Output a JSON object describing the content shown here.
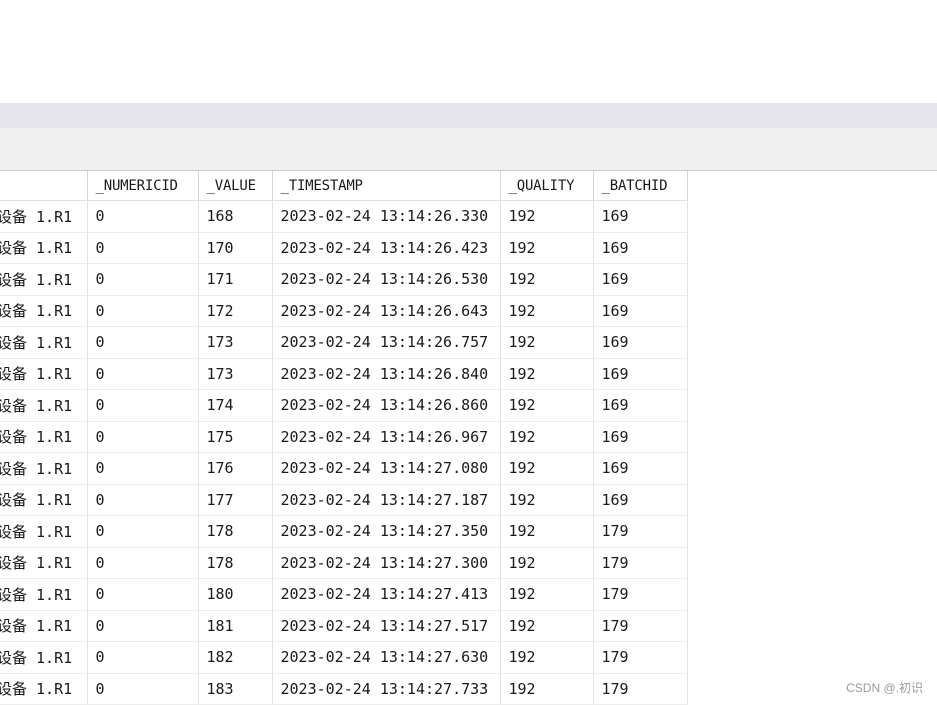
{
  "results_grid": {
    "columns": [
      "",
      "_NUMERICID",
      "_VALUE",
      "_TIMESTAMP",
      "_QUALITY",
      "_BATCHID"
    ],
    "rows": [
      [
        "设备 1.R1",
        "0",
        "168",
        "2023-02-24 13:14:26.330",
        "192",
        "169"
      ],
      [
        "设备 1.R1",
        "0",
        "170",
        "2023-02-24 13:14:26.423",
        "192",
        "169"
      ],
      [
        "设备 1.R1",
        "0",
        "171",
        "2023-02-24 13:14:26.530",
        "192",
        "169"
      ],
      [
        "设备 1.R1",
        "0",
        "172",
        "2023-02-24 13:14:26.643",
        "192",
        "169"
      ],
      [
        "设备 1.R1",
        "0",
        "173",
        "2023-02-24 13:14:26.757",
        "192",
        "169"
      ],
      [
        "设备 1.R1",
        "0",
        "173",
        "2023-02-24 13:14:26.840",
        "192",
        "169"
      ],
      [
        "设备 1.R1",
        "0",
        "174",
        "2023-02-24 13:14:26.860",
        "192",
        "169"
      ],
      [
        "设备 1.R1",
        "0",
        "175",
        "2023-02-24 13:14:26.967",
        "192",
        "169"
      ],
      [
        "设备 1.R1",
        "0",
        "176",
        "2023-02-24 13:14:27.080",
        "192",
        "169"
      ],
      [
        "设备 1.R1",
        "0",
        "177",
        "2023-02-24 13:14:27.187",
        "192",
        "169"
      ],
      [
        "设备 1.R1",
        "0",
        "178",
        "2023-02-24 13:14:27.350",
        "192",
        "179"
      ],
      [
        "设备 1.R1",
        "0",
        "178",
        "2023-02-24 13:14:27.300",
        "192",
        "179"
      ],
      [
        "设备 1.R1",
        "0",
        "180",
        "2023-02-24 13:14:27.413",
        "192",
        "179"
      ],
      [
        "设备 1.R1",
        "0",
        "181",
        "2023-02-24 13:14:27.517",
        "192",
        "179"
      ],
      [
        "设备 1.R1",
        "0",
        "182",
        "2023-02-24 13:14:27.630",
        "192",
        "179"
      ],
      [
        "设备 1.R1",
        "0",
        "183",
        "2023-02-24 13:14:27.733",
        "192",
        "179"
      ]
    ]
  },
  "watermark": "CSDN @.初识"
}
